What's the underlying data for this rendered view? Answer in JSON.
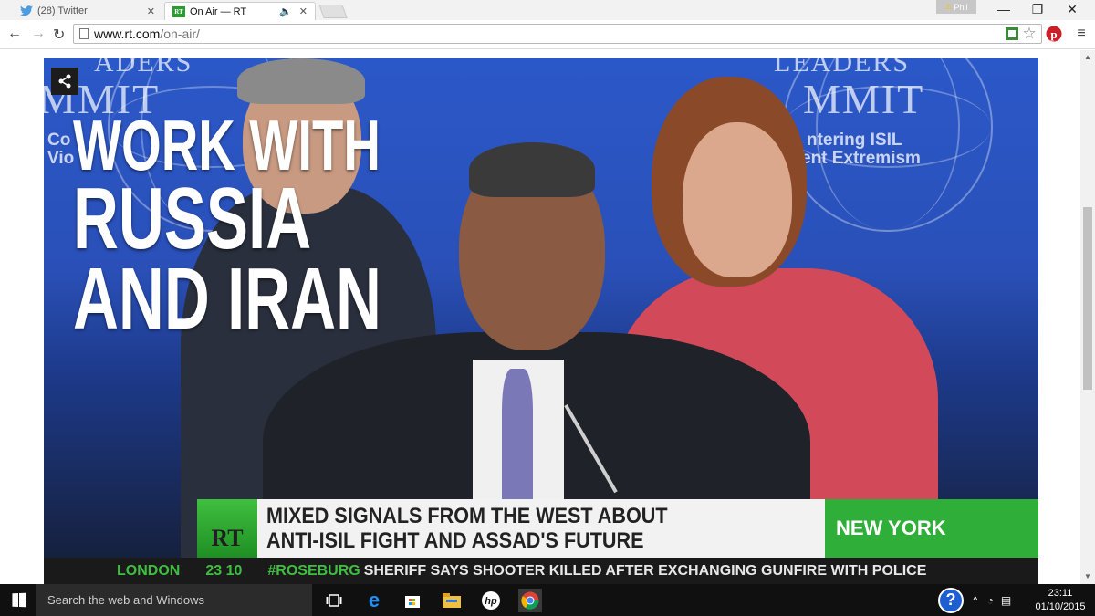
{
  "browser": {
    "tabs": [
      {
        "title": "(28) Twitter",
        "active": false
      },
      {
        "title": "On Air — RT",
        "active": true,
        "favicon_text": "RT"
      }
    ],
    "profile_name": "Phil",
    "url_host": "www.rt.com",
    "url_path": "/on-air/"
  },
  "video": {
    "backdrop_left": "MMIT",
    "backdrop_left_top": "ADERS",
    "backdrop_left_sub_1": "Co",
    "backdrop_left_sub_2": "Vio",
    "backdrop_right_top": "LEADERS",
    "backdrop_right": "MMIT",
    "backdrop_right_sub_1": "ntering ISIL",
    "backdrop_right_sub_2": "ent Extremism",
    "overlay_lines": [
      "WORK WITH",
      "RUSSIA",
      "AND IRAN"
    ],
    "logo_text": "RT",
    "headline_line_1": "MIXED SIGNALS FROM THE WEST ABOUT",
    "headline_line_2": "ANTI-ISIL FIGHT AND ASSAD'S FUTURE",
    "location": "NEW YORK",
    "ticker_city": "LONDON",
    "ticker_time": "23 10",
    "ticker_hashtag": "#ROSEBURG",
    "ticker_news": "SHERIFF SAYS SHOOTER KILLED AFTER EXCHANGING GUNFIRE WITH POLICE"
  },
  "taskbar": {
    "search_placeholder": "Search the web and Windows",
    "time": "23:11",
    "date": "01/10/2015"
  },
  "colors": {
    "rt_green": "#2fae3a",
    "backdrop_blue": "#2b58c8"
  }
}
